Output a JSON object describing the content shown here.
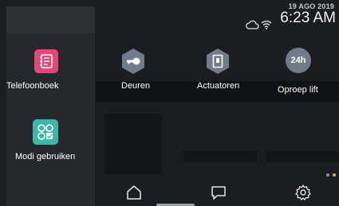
{
  "status": {
    "date": "19 AGO 2019",
    "time": "6:23 AM",
    "icons": [
      "cloud-icon",
      "wifi-icon"
    ]
  },
  "tiles": [
    {
      "label": "Telefoonboek",
      "icon": "phonebook-icon",
      "color": "#e8457a"
    },
    {
      "label": "Deuren",
      "icon": "key-icon",
      "color": "#6f7c8a"
    },
    {
      "label": "Actuatoren",
      "icon": "actuator-icon",
      "color": "#6f7c8a"
    },
    {
      "label": "Oproep lift",
      "icon": "lift-24h-icon",
      "badge": "24h",
      "color": "#6f7c8a"
    },
    {
      "label": "Modi gebruiken",
      "icon": "modes-icon",
      "color": "#3bb7a8"
    }
  ],
  "nav": [
    {
      "name": "home",
      "icon": "home-icon"
    },
    {
      "name": "messages",
      "icon": "chat-icon"
    },
    {
      "name": "settings",
      "icon": "gear-icon"
    }
  ],
  "page_dots": [
    {
      "active": false,
      "color": "#8a8f95"
    },
    {
      "active": true,
      "color": "#f0a318"
    }
  ],
  "colors": {
    "background": "#1b1d20",
    "left_panel": "#26282b",
    "accent_phonebook": "#e8457a",
    "accent_modes": "#3bb7a8",
    "hex_icon": "#6f7c8a",
    "page_dot_active": "#f0a318"
  }
}
